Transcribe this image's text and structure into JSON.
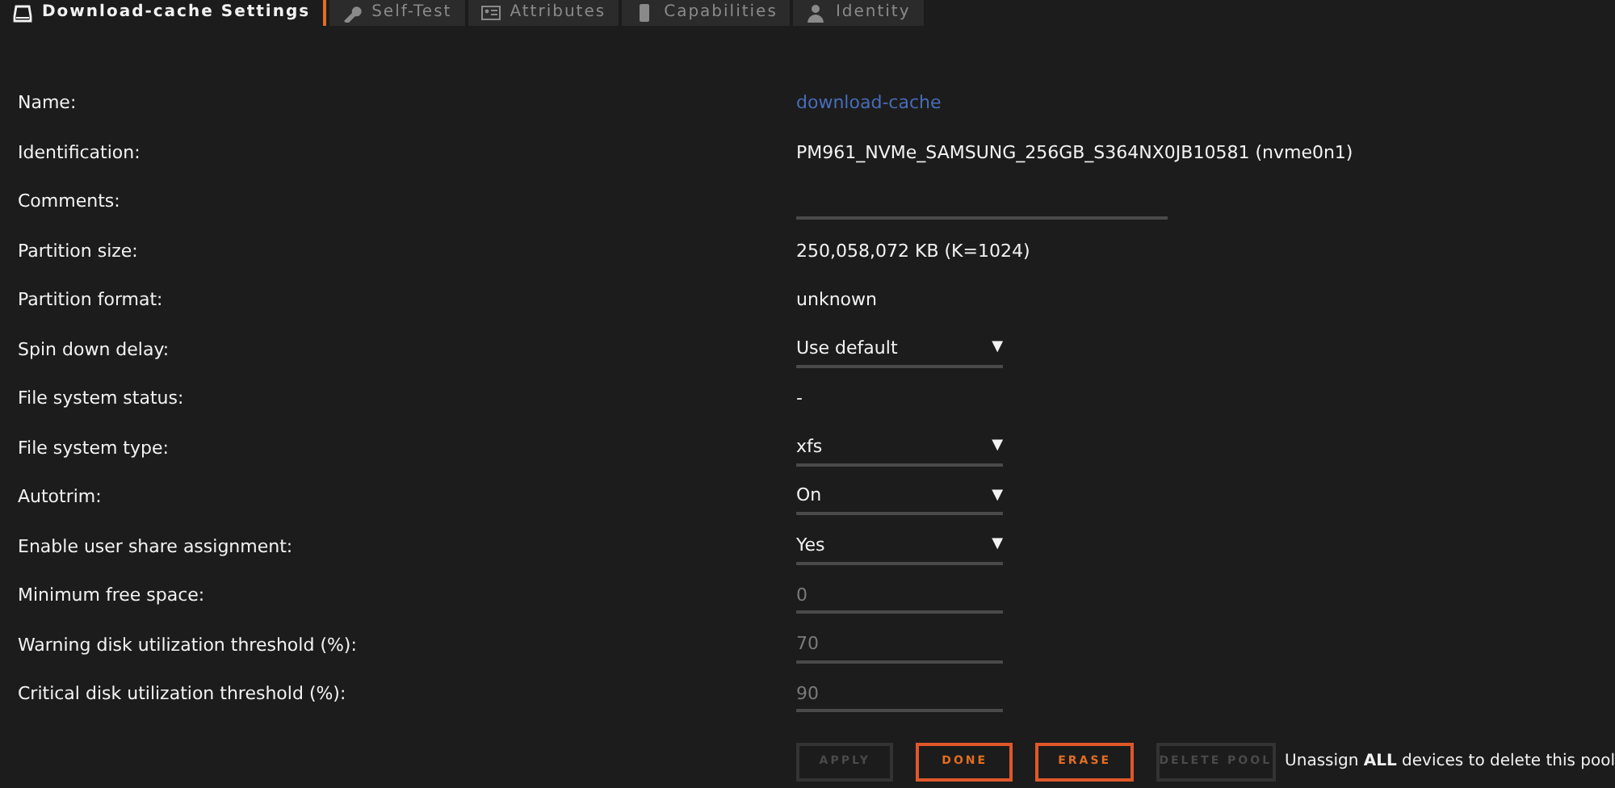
{
  "tabs": [
    {
      "label": "Download-cache Settings",
      "selected": true
    },
    {
      "label": "Self-Test",
      "selected": false
    },
    {
      "label": "Attributes",
      "selected": false
    },
    {
      "label": "Capabilities",
      "selected": false
    },
    {
      "label": "Identity",
      "selected": false
    }
  ],
  "fields": [
    {
      "label": "Name:",
      "kind": "link",
      "value": "download-cache"
    },
    {
      "label": "Identification:",
      "kind": "text",
      "value": "PM961_NVMe_SAMSUNG_256GB_S364NX0JB10581 (nvme0n1)"
    },
    {
      "label": "Comments:",
      "kind": "input"
    },
    {
      "label": "Partition size:",
      "kind": "text",
      "value": "250,058,072 KB (K=1024)"
    },
    {
      "label": "Partition format:",
      "kind": "text",
      "value": "unknown"
    },
    {
      "label": "Spin down delay:",
      "kind": "select",
      "value": "Use default",
      "arrow": "▼"
    },
    {
      "label": "File system status:",
      "kind": "text",
      "value": "-"
    },
    {
      "label": "File system type:",
      "kind": "select",
      "value": "xfs",
      "arrow": "▼"
    },
    {
      "label": "Autotrim:",
      "kind": "select",
      "value": "On",
      "arrow": "▼"
    },
    {
      "label": "Enable user share assignment:",
      "kind": "select",
      "value": "Yes",
      "arrow": "▼"
    },
    {
      "label": "Minimum free space:",
      "kind": "input",
      "placeholder": "0"
    },
    {
      "label": "Warning disk utilization threshold (%):",
      "kind": "input",
      "placeholder": "70"
    },
    {
      "label": "Critical disk utilization threshold (%):",
      "kind": "input",
      "placeholder": "90"
    }
  ],
  "buttons": [
    {
      "label": "APPLY",
      "disabled": true
    },
    {
      "label": "DONE",
      "disabled": false
    },
    {
      "label": "ERASE",
      "disabled": false
    },
    {
      "label": "DELETE POOL",
      "disabled": true
    }
  ],
  "note": "Unassign **ALL** devices to delete this pool"
}
